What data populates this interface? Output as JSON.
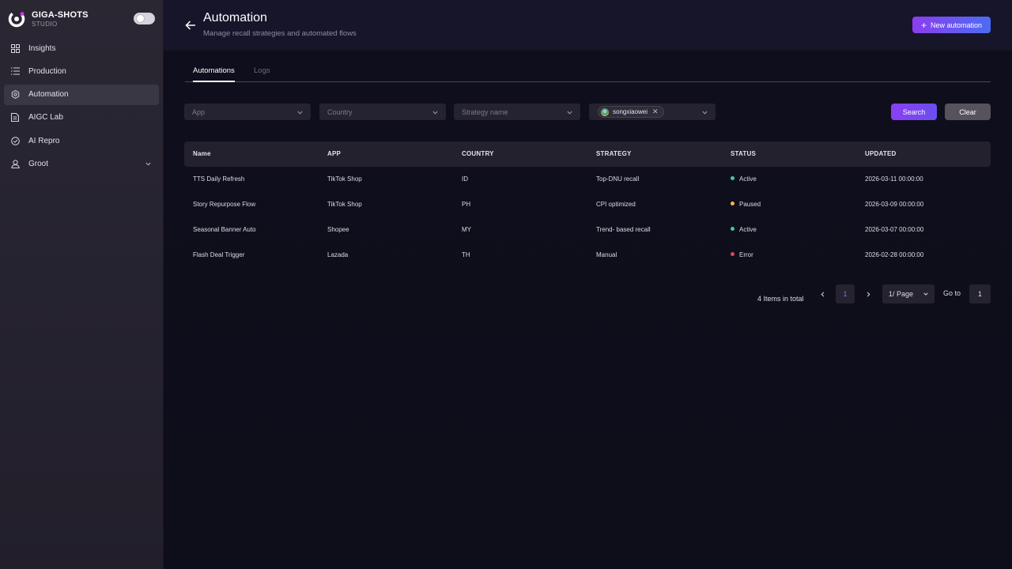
{
  "brand": {
    "name": "GIGA-SHOTS",
    "sub": "STUDIO"
  },
  "colors": {
    "accent": "#8b3df0",
    "accent2": "#4b6cf2",
    "active": "#3ecf9a",
    "paused": "#f2b84b",
    "error": "#e0455a"
  },
  "sidebar": {
    "items": [
      {
        "label": "Insights",
        "icon": "grid-icon"
      },
      {
        "label": "Production",
        "icon": "list-icon"
      },
      {
        "label": "Automation",
        "icon": "gear-icon",
        "active": true
      },
      {
        "label": "AIGC Lab",
        "icon": "document-icon"
      },
      {
        "label": "AI Repro",
        "icon": "check-circle-icon"
      },
      {
        "label": "Groot",
        "icon": "user-icon",
        "expandable": true
      }
    ]
  },
  "header": {
    "title": "Automation",
    "subtitle": "Manage recall strategies and automated flows",
    "new_button": "New automation"
  },
  "tabs": [
    {
      "label": "Automations",
      "active": true
    },
    {
      "label": "Logs",
      "active": false
    }
  ],
  "filters": {
    "app": "App",
    "country": "Country",
    "strategy": "Strategy name",
    "user_chip": "songxiaowei",
    "search": "Search",
    "clear": "Clear"
  },
  "table": {
    "headers": [
      "Name",
      "APP",
      "COUNTRY",
      "STRATEGY",
      "STATUS",
      "UPDATED"
    ],
    "rows": [
      {
        "name": "TTS Daily Refresh",
        "app": "TikTok Shop",
        "country": "ID",
        "strategy": "Top-DNU recall",
        "status": "Active",
        "updated": "2026-03-11 00:00:00"
      },
      {
        "name": "Story Repurpose Flow",
        "app": "TikTok Shop",
        "country": "PH",
        "strategy": "CPI optimized",
        "status": "Paused",
        "updated": "2026-03-09 00:00:00"
      },
      {
        "name": "Seasonal Banner Auto",
        "app": "Shopee",
        "country": "MY",
        "strategy": "Trend- based recall",
        "status": "Active",
        "updated": "2026-03-07 00:00:00"
      },
      {
        "name": "Flash Deal Trigger",
        "app": "Lazada",
        "country": "TH",
        "strategy": "Manual",
        "status": "Error",
        "updated": "2026-02-28 00:00:00"
      }
    ]
  },
  "pagination": {
    "total": "4 Items in total",
    "current_page": "1",
    "page_size": "1/ Page",
    "goto_label": "Go to",
    "goto_value": "1"
  }
}
